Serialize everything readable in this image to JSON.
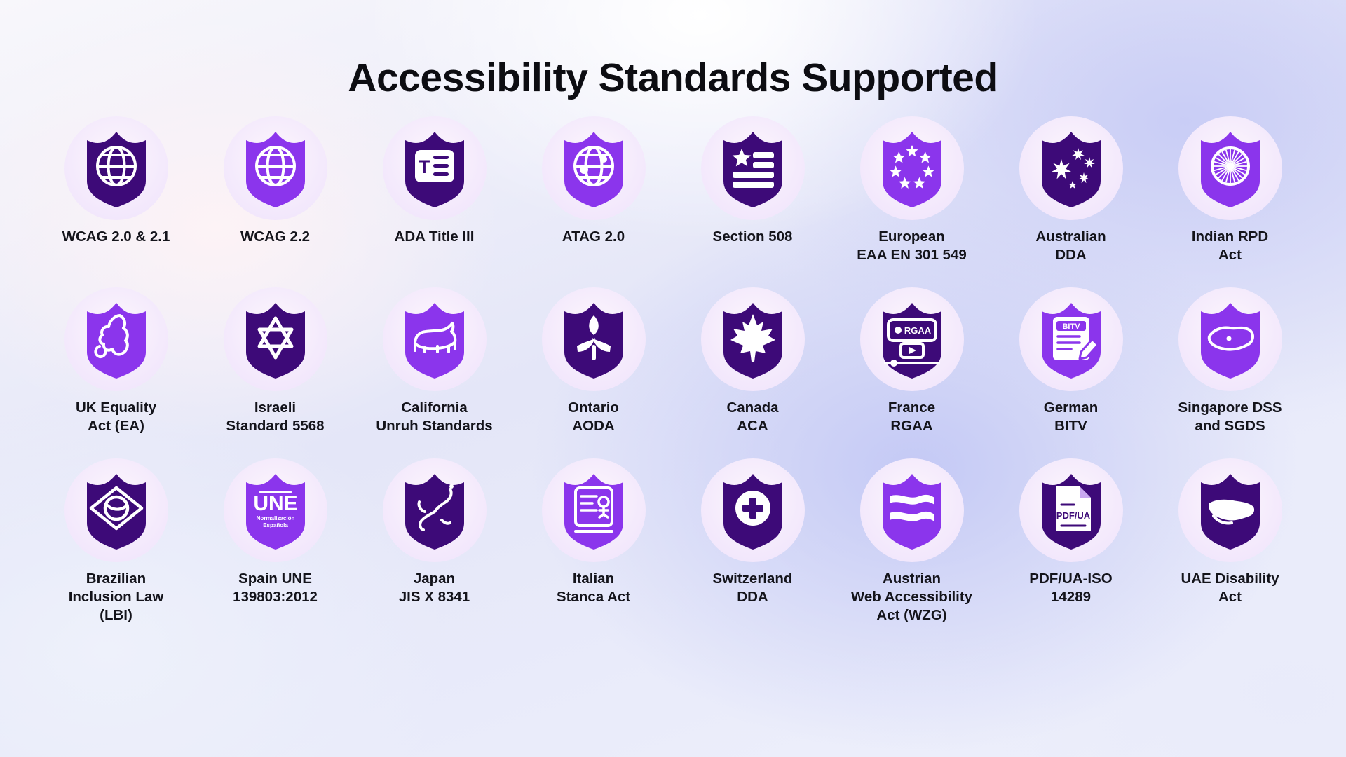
{
  "page": {
    "title": "Accessibility Standards Supported",
    "colors": {
      "shield_dark": "#3d0a78",
      "shield_light": "#8b35ec",
      "icon_white": "#ffffff",
      "text": "#14141b",
      "halo": "#f4eafc"
    }
  },
  "badges": [
    {
      "label": "WCAG 2.0 & 2.1",
      "icon": "globe-icon",
      "tone": "dark"
    },
    {
      "label": "WCAG 2.2",
      "icon": "globe-icon",
      "tone": "light"
    },
    {
      "label": "ADA Title III",
      "icon": "text-document-icon",
      "tone": "dark"
    },
    {
      "label": "ATAG 2.0",
      "icon": "globe-network-icon",
      "tone": "light"
    },
    {
      "label": "Section 508",
      "icon": "us-flag-icon",
      "tone": "dark"
    },
    {
      "label": "European\nEAA EN 301 549",
      "icon": "eu-stars-icon",
      "tone": "light"
    },
    {
      "label": "Australian\nDDA",
      "icon": "southern-cross-icon",
      "tone": "dark"
    },
    {
      "label": "Indian RPD\nAct",
      "icon": "ashoka-chakra-icon",
      "tone": "light"
    },
    {
      "label": "UK Equality\nAct (EA)",
      "icon": "uk-map-icon",
      "tone": "light"
    },
    {
      "label": "Israeli\nStandard 5568",
      "icon": "star-of-david-icon",
      "tone": "dark"
    },
    {
      "label": "California\nUnruh Standards",
      "icon": "bear-icon",
      "tone": "light"
    },
    {
      "label": "Ontario\nAODA",
      "icon": "trillium-icon",
      "tone": "dark"
    },
    {
      "label": "Canada\nACA",
      "icon": "maple-leaf-icon",
      "tone": "dark"
    },
    {
      "label": "France\nRGAA",
      "icon": "rgaa-screen-icon",
      "tone": "dark"
    },
    {
      "label": "German\nBITV",
      "icon": "bitv-document-icon",
      "tone": "light"
    },
    {
      "label": "Singapore DSS\nand SGDS",
      "icon": "singapore-map-icon",
      "tone": "light"
    },
    {
      "label": "Brazilian\nInclusion Law\n(LBI)",
      "icon": "brazil-flag-icon",
      "tone": "dark"
    },
    {
      "label": "Spain UNE\n139803:2012",
      "icon": "une-logo-icon",
      "tone": "light"
    },
    {
      "label": "Japan\nJIS X 8341",
      "icon": "japan-map-icon",
      "tone": "dark"
    },
    {
      "label": "Italian\nStanca Act",
      "icon": "stanca-display-icon",
      "tone": "light"
    },
    {
      "label": "Switzerland\nDDA",
      "icon": "swiss-cross-icon",
      "tone": "dark"
    },
    {
      "label": "Austrian\nWeb Accessibility\nAct (WZG)",
      "icon": "austria-flag-icon",
      "tone": "light"
    },
    {
      "label": "PDF/UA-ISO\n14289",
      "icon": "pdfua-file-icon",
      "tone": "dark"
    },
    {
      "label": "UAE Disability\nAct",
      "icon": "uae-map-icon",
      "tone": "dark"
    }
  ],
  "icon_inner_text": {
    "ada_letter": "T",
    "une_name": "UNE",
    "une_sub1": "Normalización",
    "une_sub2": "Española",
    "rgaa_label": "RGAA",
    "bitv_label": "BITV",
    "pdfua_label": "PDF/UA"
  }
}
